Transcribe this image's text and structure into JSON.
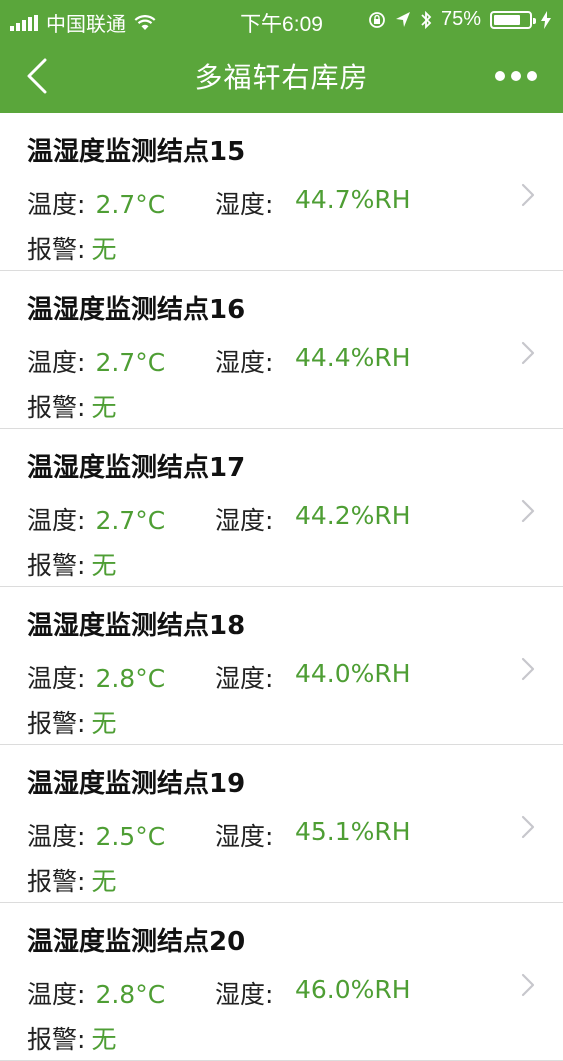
{
  "status_bar": {
    "carrier": "中国联通",
    "time": "下午6:09",
    "battery_percent": "75%",
    "battery_level": 0.75
  },
  "nav": {
    "title": "多福轩右库房",
    "back_icon": "chevron-left-icon",
    "more_icon": "more-dots-icon"
  },
  "labels": {
    "temp": "温度:",
    "humid": "湿度:",
    "alarm": "报警:"
  },
  "colors": {
    "header": "#5aa63b",
    "value_green": "#4e9e34"
  },
  "nodes": [
    {
      "name": "温湿度监测结点15",
      "temp": "2.7°C",
      "humid": "44.7%RH",
      "alarm": "无"
    },
    {
      "name": "温湿度监测结点16",
      "temp": "2.7°C",
      "humid": "44.4%RH",
      "alarm": "无"
    },
    {
      "name": "温湿度监测结点17",
      "temp": "2.7°C",
      "humid": "44.2%RH",
      "alarm": "无"
    },
    {
      "name": "温湿度监测结点18",
      "temp": "2.8°C",
      "humid": "44.0%RH",
      "alarm": "无"
    },
    {
      "name": "温湿度监测结点19",
      "temp": "2.5°C",
      "humid": "45.1%RH",
      "alarm": "无"
    },
    {
      "name": "温湿度监测结点20",
      "temp": "2.8°C",
      "humid": "46.0%RH",
      "alarm": "无"
    }
  ]
}
